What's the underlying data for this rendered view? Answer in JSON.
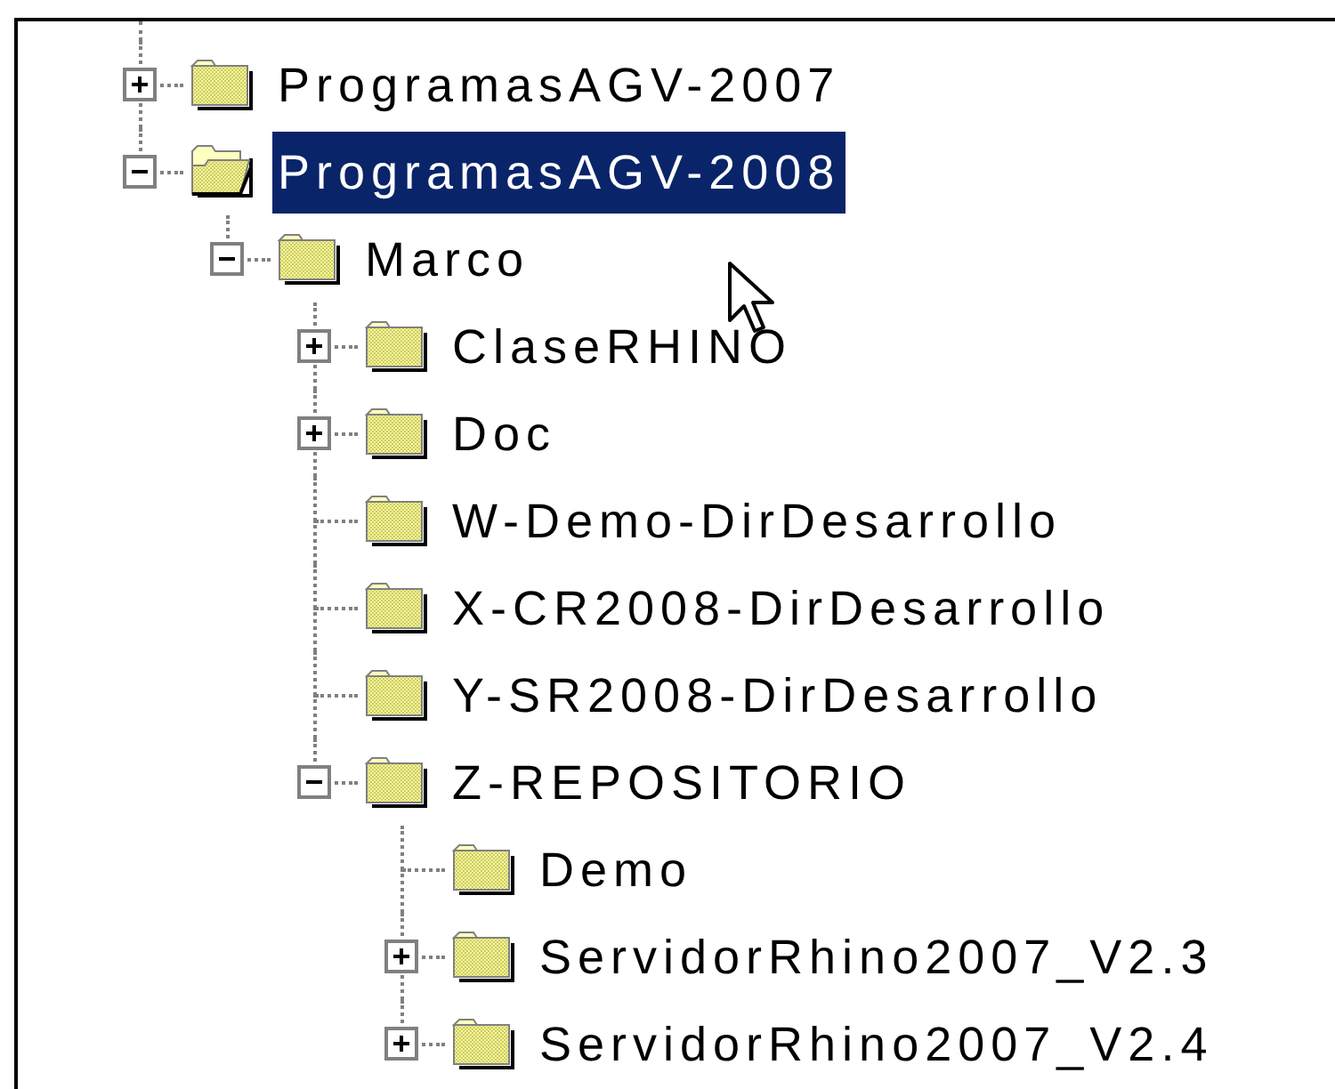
{
  "tree": [
    {
      "label": "ProgramasAGV-2007",
      "expanded": false,
      "selected": false
    },
    {
      "label": "ProgramasAGV-2008",
      "expanded": true,
      "selected": true,
      "children": [
        {
          "label": "Marco",
          "expanded": true,
          "selected": false,
          "children": [
            {
              "label": "ClaseRHINO",
              "expanded": false,
              "selected": false
            },
            {
              "label": "Doc",
              "expanded": false,
              "selected": false
            },
            {
              "label": "W-Demo-DirDesarrollo",
              "selected": false
            },
            {
              "label": "X-CR2008-DirDesarrollo",
              "selected": false
            },
            {
              "label": "Y-SR2008-DirDesarrollo",
              "selected": false
            },
            {
              "label": "Z-REPOSITORIO",
              "expanded": true,
              "selected": false,
              "children": [
                {
                  "label": "Demo",
                  "selected": false
                },
                {
                  "label": "ServidorRhino2007_V2.3",
                  "expanded": false,
                  "selected": false
                },
                {
                  "label": "ServidorRhino2007_V2.4",
                  "expanded": false,
                  "selected": false
                }
              ]
            }
          ]
        }
      ]
    }
  ]
}
